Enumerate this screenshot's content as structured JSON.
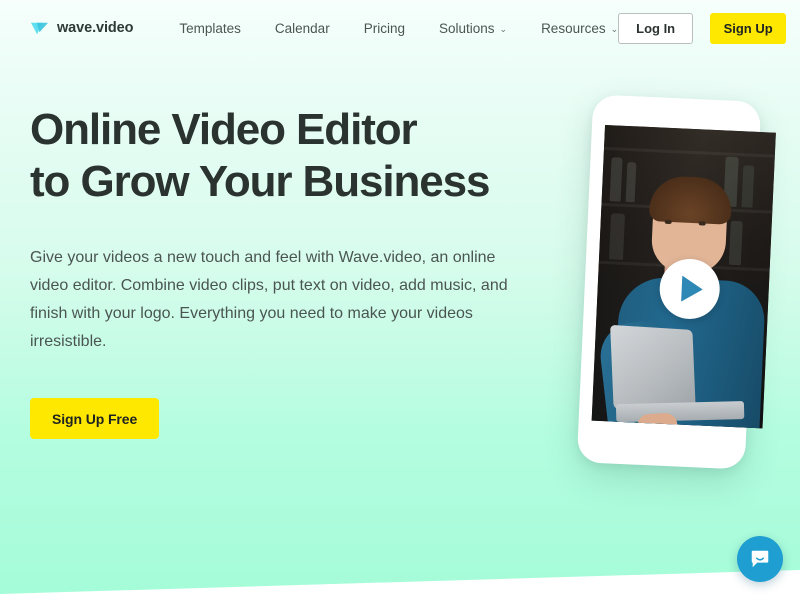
{
  "brand": {
    "name": "wave.video",
    "logo_icon": "wave-play-logo-icon",
    "logo_color": "#4fd2e8"
  },
  "nav": {
    "links": [
      {
        "label": "Templates",
        "has_caret": false
      },
      {
        "label": "Calendar",
        "has_caret": false
      },
      {
        "label": "Pricing",
        "has_caret": false
      },
      {
        "label": "Solutions",
        "has_caret": true,
        "caret": "⌄"
      },
      {
        "label": "Resources",
        "has_caret": true,
        "caret": "⌄"
      }
    ],
    "login_label": "Log In",
    "signup_label": "Sign Up"
  },
  "hero": {
    "headline_line1": "Online Video Editor",
    "headline_line2": "to Grow Your Business",
    "paragraph": "Give your videos a new touch and feel with Wave.video, an online video editor. Combine video clips, put text on video, add music, and finish with your logo. Everything you need to make your videos irresistible.",
    "cta_label": "Sign Up Free",
    "cta_color": "#ffe800",
    "headline_color": "#2b3331",
    "background_top": "#f6fffc",
    "background_bottom": "#a4fcd8"
  },
  "media": {
    "device": "smartphone-mockup",
    "play_button_icon": "play-icon",
    "play_button_color": "#2e88b5",
    "photo_description": "bearded man in blue sweater holding a laptop"
  },
  "chat": {
    "icon": "chat-bubble-icon",
    "color": "#1f9ed2"
  }
}
